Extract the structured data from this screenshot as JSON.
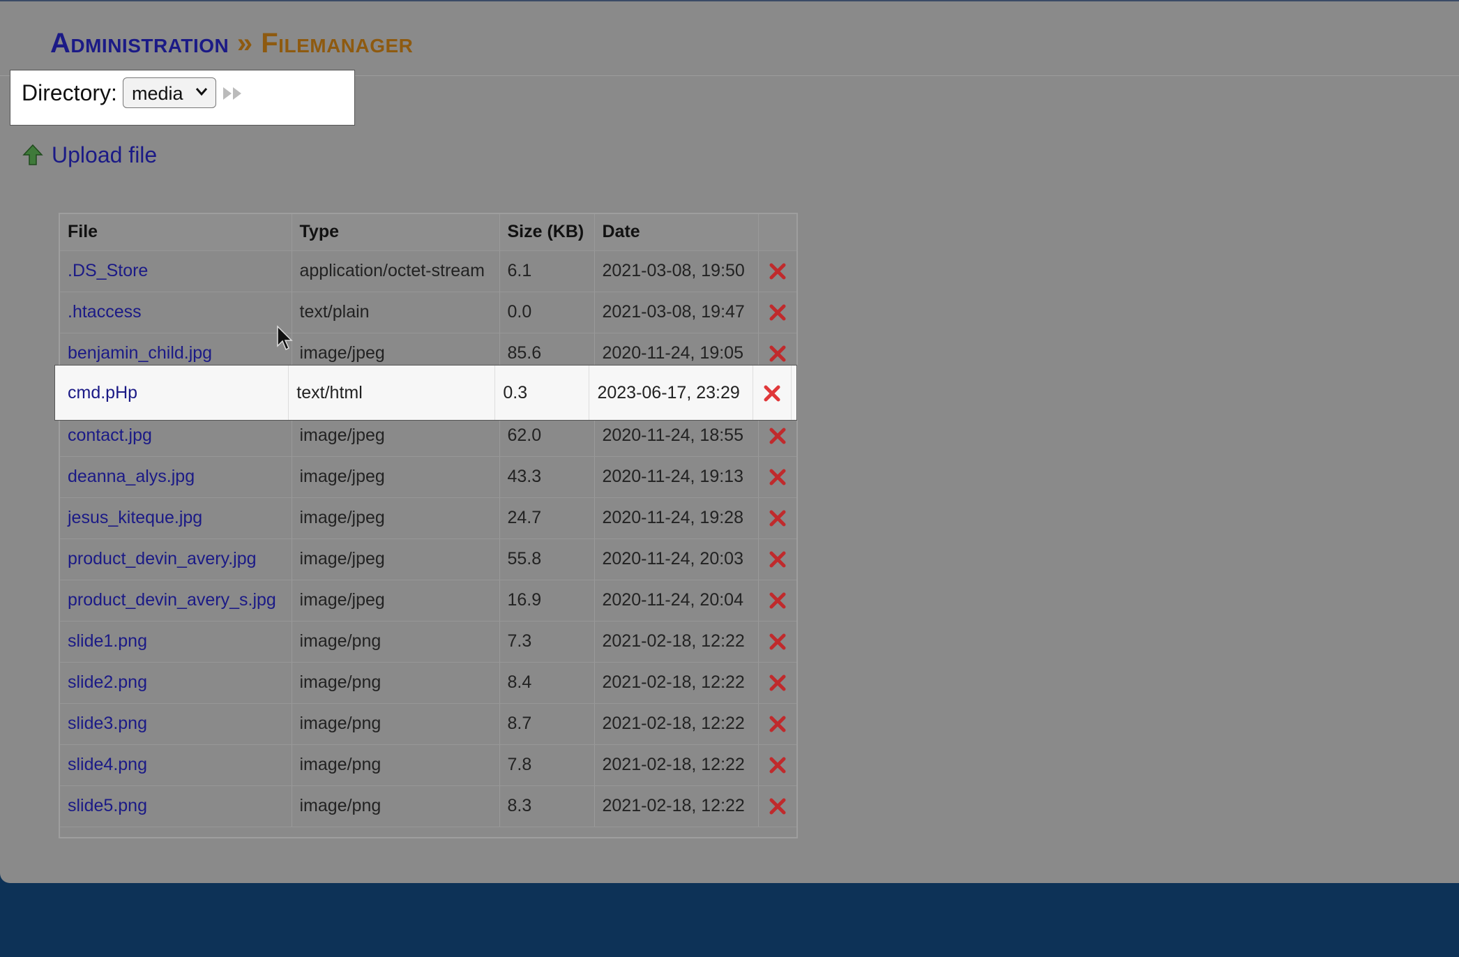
{
  "header": {
    "admin": "Administration",
    "sep": "»",
    "section": "Filemanager"
  },
  "directory": {
    "label": "Directory:",
    "selected": "media"
  },
  "upload": {
    "label": "Upload file"
  },
  "table": {
    "headers": [
      "File",
      "Type",
      "Size (KB)",
      "Date"
    ],
    "rows": [
      {
        "file": ".DS_Store",
        "type": "application/octet-stream",
        "size": "6.1",
        "date": "2021-03-08, 19:50"
      },
      {
        "file": ".htaccess",
        "type": "text/plain",
        "size": "0.0",
        "date": "2021-03-08, 19:47"
      },
      {
        "file": "benjamin_child.jpg",
        "type": "image/jpeg",
        "size": "85.6",
        "date": "2020-11-24, 19:05"
      },
      {
        "file": "cmd.pHp",
        "type": "text/html",
        "size": "0.3",
        "date": "2023-06-17, 23:29"
      },
      {
        "file": "contact.jpg",
        "type": "image/jpeg",
        "size": "62.0",
        "date": "2020-11-24, 18:55"
      },
      {
        "file": "deanna_alys.jpg",
        "type": "image/jpeg",
        "size": "43.3",
        "date": "2020-11-24, 19:13"
      },
      {
        "file": "jesus_kiteque.jpg",
        "type": "image/jpeg",
        "size": "24.7",
        "date": "2020-11-24, 19:28"
      },
      {
        "file": "product_devin_avery.jpg",
        "type": "image/jpeg",
        "size": "55.8",
        "date": "2020-11-24, 20:03"
      },
      {
        "file": "product_devin_avery_s.jpg",
        "type": "image/jpeg",
        "size": "16.9",
        "date": "2020-11-24, 20:04"
      },
      {
        "file": "slide1.png",
        "type": "image/png",
        "size": "7.3",
        "date": "2021-02-18, 12:22"
      },
      {
        "file": "slide2.png",
        "type": "image/png",
        "size": "8.4",
        "date": "2021-02-18, 12:22"
      },
      {
        "file": "slide3.png",
        "type": "image/png",
        "size": "8.7",
        "date": "2021-02-18, 12:22"
      },
      {
        "file": "slide4.png",
        "type": "image/png",
        "size": "7.8",
        "date": "2021-02-18, 12:22"
      },
      {
        "file": "slide5.png",
        "type": "image/png",
        "size": "8.3",
        "date": "2021-02-18, 12:22"
      }
    ]
  },
  "icons": {
    "delete": "close-x-icon",
    "upload": "arrow-up-icon",
    "go": "fast-forward-icon",
    "select": "chevron-down-icon"
  },
  "colors": {
    "link": "#1b1a86",
    "section": "#8e5a10",
    "delete": "#e0383a",
    "footer": "#0d3257",
    "overlay": "#8a8a8a"
  }
}
